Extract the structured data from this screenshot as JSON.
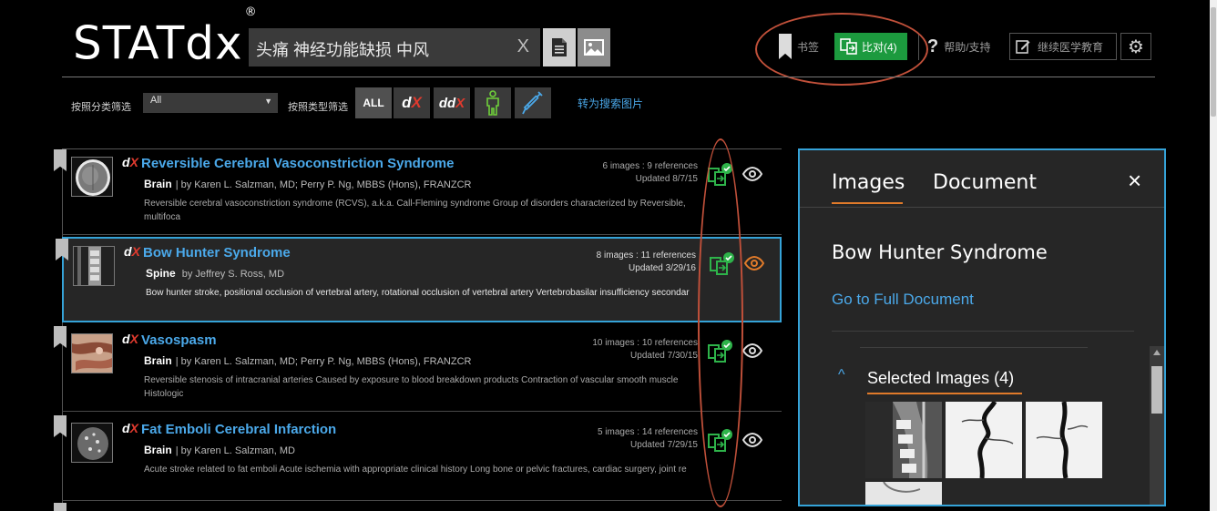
{
  "header": {
    "logo": "STATdx",
    "logo_mark": "®",
    "search_query": "头痛 神经功能缺损 中风",
    "clear_icon": "X",
    "bookmarks_label": "书签",
    "compare_label": "比对(4)",
    "help_label": "帮助/支持",
    "cme_label": "继续医学教育"
  },
  "filters": {
    "category_label": "按照分类筛选",
    "category_value": "All",
    "type_label": "按照类型筛选",
    "type_buttons": {
      "all": "ALL",
      "dx": "dX",
      "ddx_a": "dd",
      "ddx_b": "X"
    },
    "search_images_link": "转为搜索图片"
  },
  "results": [
    {
      "title": "Reversible Cerebral Vasoconstriction Syndrome",
      "type_icon": "dX",
      "section": "Brain",
      "authors": "| by Karen L. Salzman, MD; Perry P. Ng, MBBS (Hons), FRANZCR",
      "snippet": "Reversible cerebral vasoconstriction syndrome (RCVS), a.k.a. Call-Fleming syndrome Group of disorders characterized by Reversible, multifoca",
      "counts": "6 images : 9 references",
      "updated": "Updated 8/7/15",
      "selected": false
    },
    {
      "title": "Bow Hunter Syndrome",
      "type_icon": "dX",
      "section": "Spine",
      "authors": "by Jeffrey S. Ross, MD",
      "snippet": "Bow hunter stroke, positional occlusion of vertebral artery, rotational occlusion of vertebral artery Vertebrobasilar insufficiency secondar",
      "counts": "8 images : 11 references",
      "updated": "Updated 3/29/16",
      "selected": true
    },
    {
      "title": "Vasospasm",
      "type_icon": "dX",
      "section": "Brain",
      "authors": "| by Karen L. Salzman, MD; Perry P. Ng, MBBS (Hons), FRANZCR",
      "snippet": "Reversible stenosis of intracranial arteries Caused by exposure to blood breakdown products Contraction of vascular smooth muscle Histologic",
      "counts": "10 images : 10 references",
      "updated": "Updated 7/30/15",
      "selected": false
    },
    {
      "title": "Fat Emboli Cerebral Infarction",
      "type_icon": "dX",
      "section": "Brain",
      "authors": "| by Karen L. Salzman, MD",
      "snippet": "Acute stroke related to fat emboli Acute ischemia with appropriate clinical history Long bone or pelvic fractures, cardiac surgery, joint re",
      "counts": "5 images : 14 references",
      "updated": "Updated 7/29/15",
      "selected": false
    }
  ],
  "panel": {
    "tab_images": "Images",
    "tab_document": "Document",
    "close": "×",
    "doc_title": "Bow Hunter Syndrome",
    "full_doc_link": "Go to Full Document",
    "selected_images_label": "Selected Images (4)",
    "chevron": "^"
  },
  "colors": {
    "accent_blue": "#4ba9ea",
    "selection_border": "#35a3d8",
    "compare_green": "#1c9a3e",
    "annotation_red": "#c0503a",
    "tab_orange": "#e07a2a"
  }
}
